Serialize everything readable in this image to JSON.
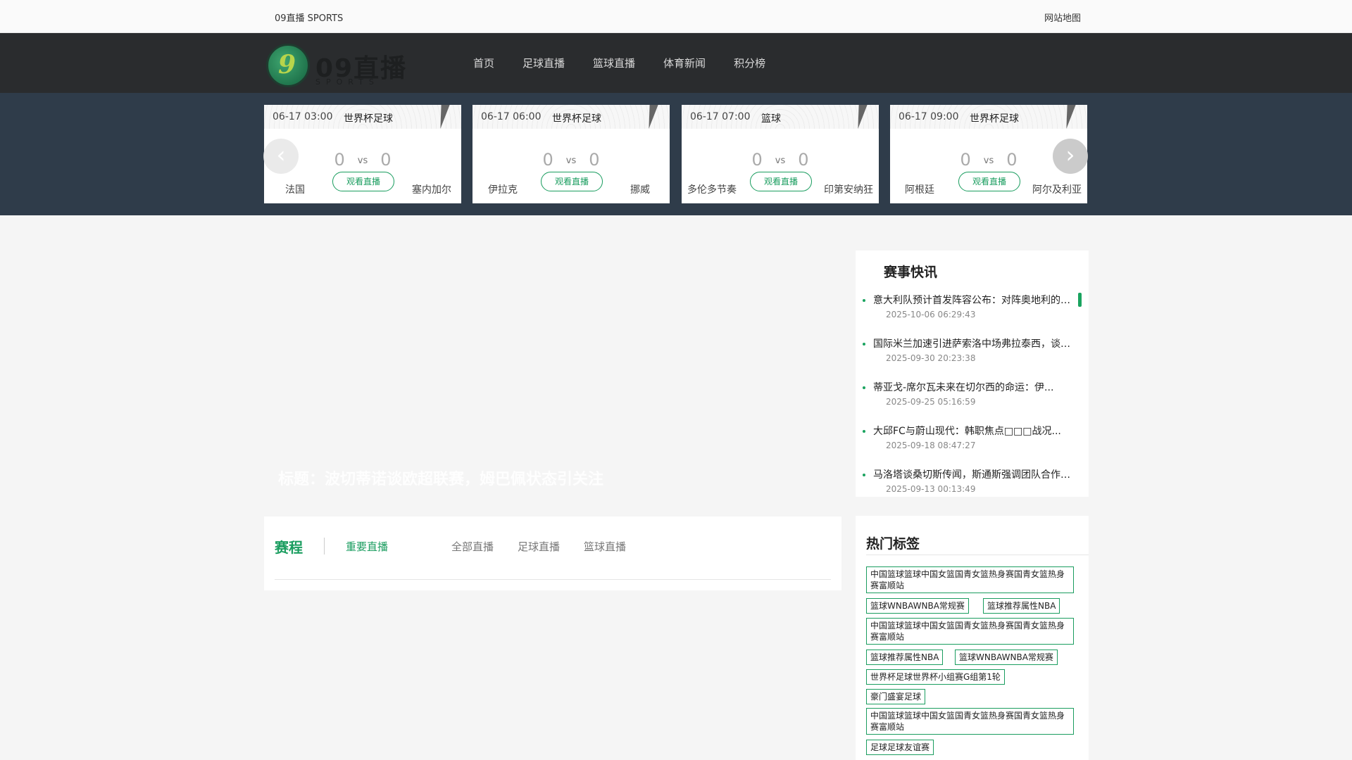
{
  "topbar": {
    "brand": "09直播 SPORTS",
    "sitemap": "网站地图"
  },
  "logo": {
    "word": "09直播",
    "sub": "SPORTS"
  },
  "nav": [
    "首页",
    "足球直播",
    "篮球直播",
    "体育新闻",
    "积分榜"
  ],
  "matches": [
    {
      "time": "06-17 03:00",
      "league": "世界杯足球",
      "home": "法国",
      "away": "塞内加尔",
      "home_score": "0",
      "away_score": "0",
      "vs": "vs",
      "watch": "观看直播"
    },
    {
      "time": "06-17 06:00",
      "league": "世界杯足球",
      "home": "伊拉克",
      "away": "挪威",
      "home_score": "0",
      "away_score": "0",
      "vs": "vs",
      "watch": "观看直播"
    },
    {
      "time": "06-17 07:00",
      "league": "篮球",
      "home": "多伦多节奏",
      "away": "印第安纳狂",
      "home_score": "0",
      "away_score": "0",
      "vs": "vs",
      "watch": "观看直播"
    },
    {
      "time": "06-17 09:00",
      "league": "世界杯足球",
      "home": "阿根廷",
      "away": "阿尔及利亚",
      "home_score": "0",
      "away_score": "0",
      "vs": "vs",
      "watch": "观看直播"
    }
  ],
  "banner": {
    "title": "标题：波切蒂诺谈欧超联赛，姆巴佩状态引关注"
  },
  "news": {
    "title": "赛事快讯",
    "items": [
      {
        "t": "意大利队预计首发阵容公布：对阵奥地利的关键一战",
        "d": "2025-10-06 06:29:43"
      },
      {
        "t": "国际米兰加速引进萨索洛中场弗拉泰西，谈判进入最后阶段",
        "d": "2025-09-30 20:23:38"
      },
      {
        "t": "蒂亚戈-席尔瓦未来在切尔西的命运：伊...",
        "d": "2025-09-25 05:16:59"
      },
      {
        "t": "大邱FC与蔚山现代：韩职焦点□□□战况...",
        "d": "2025-09-18 08:47:27"
      },
      {
        "t": "马洛塔谈桑切斯传闻，斯通斯强调团队合作精神",
        "d": "2025-09-13 00:13:49"
      }
    ]
  },
  "schedule": {
    "title": "赛程",
    "tabs": [
      "重要直播",
      "全部直播",
      "足球直播",
      "篮球直播"
    ]
  },
  "tags": {
    "title": "热门标签",
    "items": [
      "中国篮球篮球中国女篮国青女篮热身赛国青女篮热身赛富顺站",
      "篮球WNBAWNBA常规赛",
      "篮球推荐属性NBA",
      "中国篮球篮球中国女篮国青女篮热身赛国青女篮热身赛富顺站",
      "篮球推荐属性NBA",
      "篮球WNBAWNBA常规赛",
      "世界杯足球世界杯小组赛G组第1轮",
      "豪门盛宴足球",
      "中国篮球篮球中国女篮国青女篮热身赛国青女篮热身赛富顺站",
      "足球足球友谊赛"
    ]
  },
  "colors": {
    "accent": "#1a9d5f",
    "nav_bg": "#2a2c2e",
    "strip_bg": "#2f3c4a"
  },
  "icons": {
    "prev": "chevron-left-icon",
    "next": "chevron-right-icon"
  }
}
